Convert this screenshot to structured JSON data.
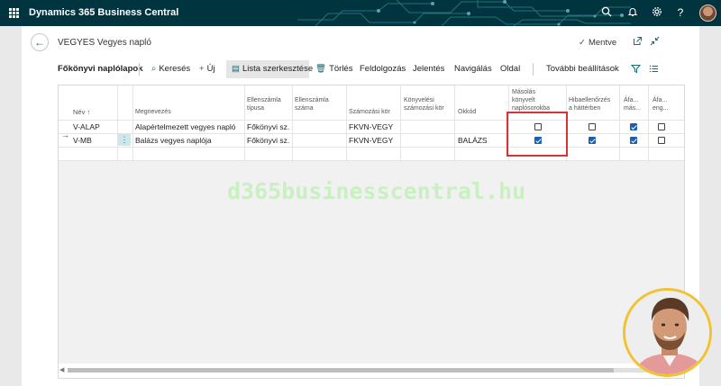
{
  "app": {
    "title": "Dynamics 365 Business Central"
  },
  "topbar_icons": [
    "search-icon",
    "bell-icon",
    "gear-icon",
    "help-icon"
  ],
  "page": {
    "title": "VEGYES Vegyes napló",
    "saved_label": "Mentve"
  },
  "actions": {
    "section_label": "Főkönyvi naplólapok",
    "search": "Keresés",
    "new": "Új",
    "edit_list": "Lista szerkesztése",
    "delete": "Törlés",
    "process": "Feldolgozás",
    "report": "Jelentés",
    "navigate": "Navigálás",
    "page": "Oldal",
    "more": "További beállítások"
  },
  "columns": {
    "name": "Név ↑",
    "description": "Megnevezés",
    "bal_account_type": [
      "Ellenszámla",
      "típusa"
    ],
    "bal_account_no": [
      "Ellenszámla",
      "száma"
    ],
    "no_series": "Számozási kör",
    "posting_no_series": [
      "Könyvelési",
      "számozási kör"
    ],
    "reason_code": "Okkód",
    "copy_to_posted": [
      "Másolás",
      "könyvelt",
      "naplósorokba"
    ],
    "background_check": [
      "Hibaellenőrzés",
      "a háttérben"
    ],
    "vat_copy": [
      "Áfa...",
      "más..."
    ],
    "vat_allow": [
      "Áfa...",
      "eng..."
    ]
  },
  "rows": [
    {
      "name": "V-ALAP",
      "description": "Alapértelmezett vegyes napló",
      "bal_account_type": "Főkönyvi sz...",
      "bal_account_no": "",
      "no_series": "FKVN-VEGY",
      "posting_no_series": "",
      "reason_code": "",
      "copy_to_posted": false,
      "background_check": false,
      "vat_copy": true,
      "vat_allow": false
    },
    {
      "name": "V-MB",
      "description": "Balázs vegyes naplója",
      "bal_account_type": "Főkönyvi sz...",
      "bal_account_no": "",
      "no_series": "FKVN-VEGY",
      "posting_no_series": "",
      "reason_code": "BALÁZS",
      "copy_to_posted": true,
      "background_check": true,
      "vat_copy": true,
      "vat_allow": false
    }
  ],
  "watermark": "d365businesscentral.hu",
  "colors": {
    "topbar": "#00353f",
    "accent": "#1a6a7a",
    "highlight": "#d9333a",
    "watermark": "#c9f0c0"
  }
}
